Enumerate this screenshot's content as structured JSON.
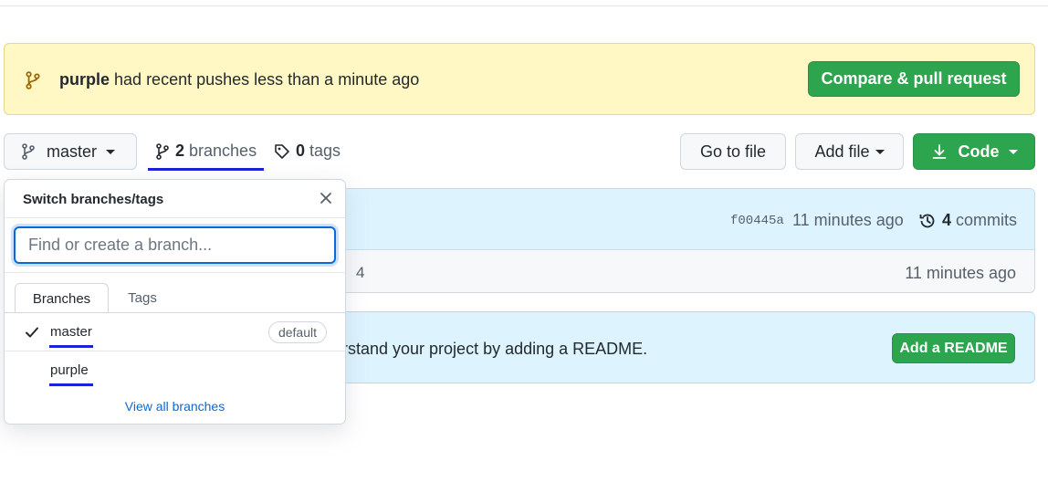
{
  "banner": {
    "branch": "purple",
    "message": "had recent pushes less than a minute ago",
    "compare_label": "Compare & pull request"
  },
  "toolbar": {
    "branch_button_label": "master",
    "branches_count": "2",
    "branches_label": "branches",
    "tags_count": "0",
    "tags_label": "tags",
    "go_to_file_label": "Go to file",
    "add_file_label": "Add file",
    "code_label": "Code"
  },
  "commit_bar": {
    "sha": "f00445a",
    "time": "11 minutes ago",
    "commits_count": "4",
    "commits_label": "commits"
  },
  "file_row": {
    "message": "4",
    "time": "11 minutes ago"
  },
  "readme_prompt": {
    "text": "rstand your project by adding a README.",
    "button_label": "Add a README"
  },
  "branch_dropdown": {
    "title": "Switch branches/tags",
    "search_placeholder": "Find or create a branch...",
    "tabs": [
      {
        "label": "Branches",
        "selected": true
      },
      {
        "label": "Tags",
        "selected": false
      }
    ],
    "branches": [
      {
        "name": "master",
        "badge": "default",
        "selected": true
      },
      {
        "name": "purple",
        "selected": false
      }
    ],
    "view_all_label": "View all branches"
  },
  "icons": {
    "branch": "git-branch-icon",
    "tag": "tag-icon",
    "close": "close-icon",
    "check": "check-icon",
    "download": "download-icon",
    "history": "history-icon"
  },
  "colors": {
    "primary_green": "#2da44e",
    "banner_bg": "#fff8c5",
    "info_bg": "#ddf4ff",
    "link_blue": "#0969da",
    "focus_underline": "#1a23d8"
  }
}
